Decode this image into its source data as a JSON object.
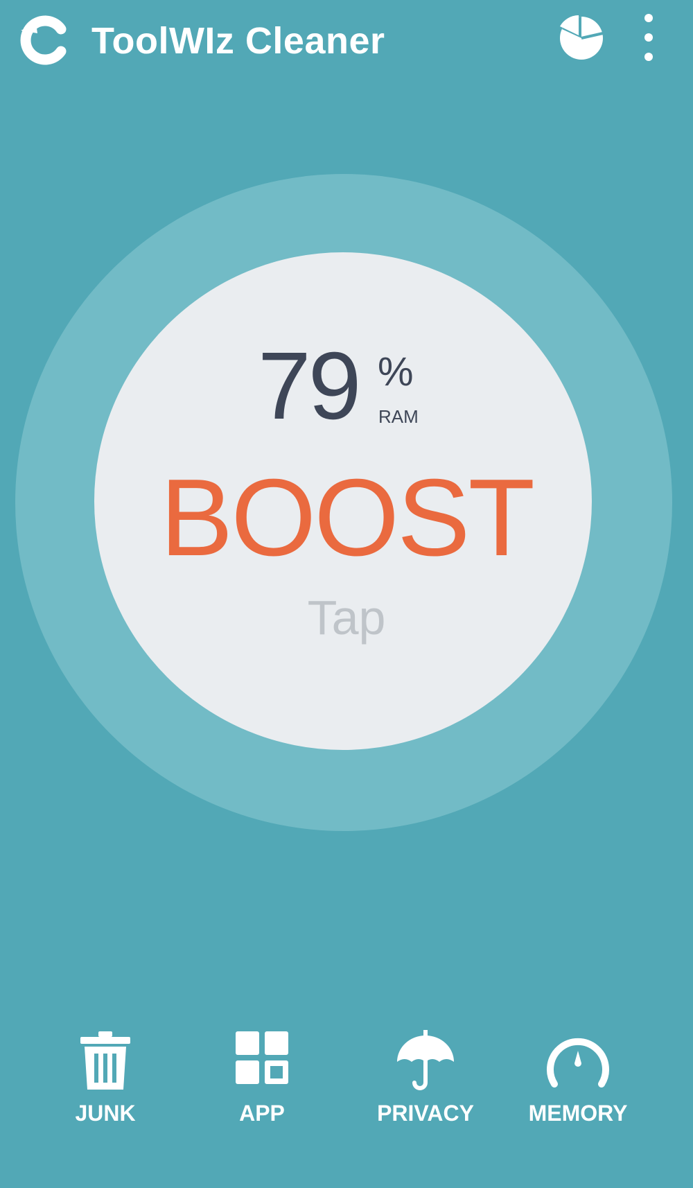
{
  "app": {
    "title": "ToolWIz Cleaner",
    "logo_icon": "toolwiz-logo-icon",
    "stats_icon": "pie-chart-icon",
    "menu_icon": "more-vertical-icon"
  },
  "boost": {
    "ram_percent": "79",
    "percent_sign": "%",
    "ram_label": "RAM",
    "action_label": "BOOST",
    "hint": "Tap"
  },
  "nav": {
    "items": [
      {
        "label": "JUNK",
        "icon": "trash-icon"
      },
      {
        "label": "APP",
        "icon": "app-grid-icon"
      },
      {
        "label": "PRIVACY",
        "icon": "umbrella-icon"
      },
      {
        "label": "MEMORY",
        "icon": "gauge-icon"
      }
    ]
  },
  "colors": {
    "background": "#52a8b6",
    "ring": "#72bbc6",
    "circle": "#eaedf0",
    "boost": "#ea6a3f",
    "ram_text": "#3e4657",
    "tap_text": "#bfc4c9"
  }
}
